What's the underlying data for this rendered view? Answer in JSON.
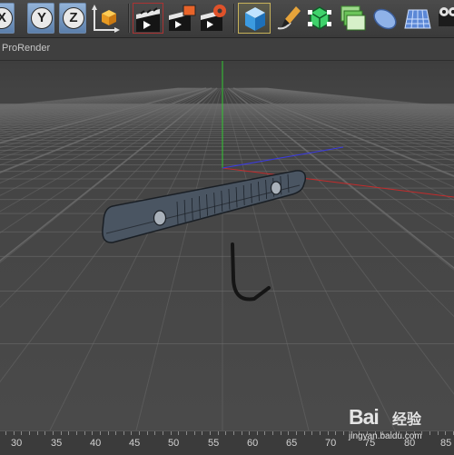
{
  "toolbar": {
    "axis_buttons": [
      {
        "label": "X"
      },
      {
        "label": "Y"
      },
      {
        "label": "Z"
      }
    ],
    "icons": [
      "world-coordinates-icon",
      "render-view-icon",
      "render-to-picture-viewer-icon",
      "render-settings-icon",
      "cube-icon",
      "pen-spline-icon",
      "subdivision-surface-icon",
      "array-icon",
      "deformer-icon",
      "floor-icon",
      "camera-icon"
    ]
  },
  "view": {
    "title": "ProRender"
  },
  "ruler": {
    "labels": [
      "30",
      "35",
      "40",
      "45",
      "50",
      "55",
      "60",
      "65",
      "70",
      "75",
      "80",
      "85"
    ]
  },
  "watermark": {
    "logo": "Bai",
    "text": "经验",
    "url": "jingyan.baidu.com"
  },
  "colors": {
    "axis_x": "#c42b2b",
    "axis_y": "#32c832",
    "axis_z": "#3a3ae0",
    "grid": "#6e6e6e",
    "object": "#4a5562"
  }
}
